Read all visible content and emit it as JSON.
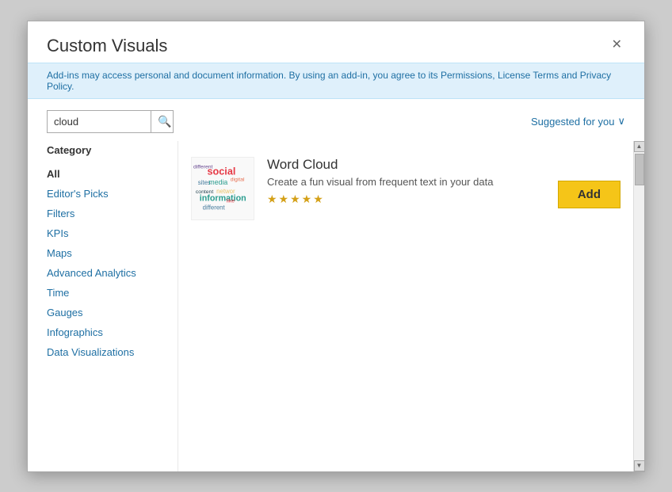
{
  "dialog": {
    "title": "Custom Visuals",
    "close_label": "✕"
  },
  "notice": {
    "text": "Add-ins may access personal and document information. By using an add-in, you agree to its Permissions, License Terms and Privacy Policy."
  },
  "search": {
    "value": "cloud",
    "placeholder": "cloud",
    "search_icon": "🔍",
    "suggested_label": "Suggested for you",
    "chevron": "∨"
  },
  "sidebar": {
    "category_label": "Category",
    "items": [
      {
        "label": "All",
        "active": true
      },
      {
        "label": "Editor's Picks"
      },
      {
        "label": "Filters"
      },
      {
        "label": "KPIs"
      },
      {
        "label": "Maps"
      },
      {
        "label": "Advanced Analytics"
      },
      {
        "label": "Time"
      },
      {
        "label": "Gauges"
      },
      {
        "label": "Infographics"
      },
      {
        "label": "Data Visualizations"
      }
    ]
  },
  "results": {
    "items": [
      {
        "name": "Word Cloud",
        "description": "Create a fun visual from frequent text in your data",
        "stars": "★★★★★",
        "add_label": "Add"
      }
    ]
  },
  "scrollbar": {
    "up_arrow": "▲",
    "down_arrow": "▼"
  }
}
